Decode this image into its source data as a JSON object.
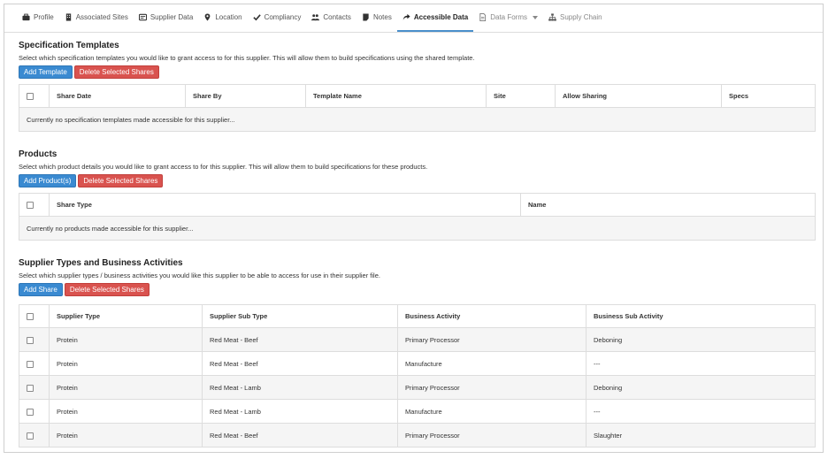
{
  "tabs": [
    {
      "label": "Profile",
      "icon": "briefcase-icon"
    },
    {
      "label": "Associated Sites",
      "icon": "building-icon"
    },
    {
      "label": "Supplier Data",
      "icon": "id-card-icon"
    },
    {
      "label": "Location",
      "icon": "map-marker-icon"
    },
    {
      "label": "Compliancy",
      "icon": "check-icon"
    },
    {
      "label": "Contacts",
      "icon": "users-icon"
    },
    {
      "label": "Notes",
      "icon": "note-icon"
    },
    {
      "label": "Accessible Data",
      "icon": "share-icon"
    },
    {
      "label": "Data Forms",
      "icon": "file-icon"
    },
    {
      "label": "Supply Chain",
      "icon": "sitemap-icon"
    }
  ],
  "active_tab": "Accessible Data",
  "colors": {
    "primary": "#3a8ad1",
    "danger": "#d9534f",
    "active_underline": "#4a8fcb"
  },
  "spec_templates": {
    "title": "Specification Templates",
    "description": "Select which specification templates you would like to grant access to for this supplier. This will allow them to build specifications using the shared template.",
    "add_label": "Add Template",
    "delete_label": "Delete Selected Shares",
    "columns": [
      "Share Date",
      "Share By",
      "Template Name",
      "Site",
      "Allow Sharing",
      "Specs"
    ],
    "empty_text": "Currently no specification templates made accessible for this supplier..."
  },
  "products": {
    "title": "Products",
    "description": "Select which product details you would like to grant access to for this supplier. This will allow them to build specifications for these products.",
    "add_label": "Add Product(s)",
    "delete_label": "Delete Selected Shares",
    "columns": [
      "Share Type",
      "Name"
    ],
    "empty_text": "Currently no products made accessible for this supplier..."
  },
  "supplier_types": {
    "title": "Supplier Types and Business Activities",
    "description": "Select which supplier types / business activities you would like this supplier to be able to access for use in their supplier file.",
    "add_label": "Add Share",
    "delete_label": "Delete Selected Shares",
    "columns": [
      "Supplier Type",
      "Supplier Sub Type",
      "Business Activity",
      "Business Sub Activity"
    ],
    "rows": [
      [
        "Protein",
        "Red Meat - Beef",
        "Primary Processor",
        "Deboning"
      ],
      [
        "Protein",
        "Red Meat - Beef",
        "Manufacture",
        "---"
      ],
      [
        "Protein",
        "Red Meat - Lamb",
        "Primary Processor",
        "Deboning"
      ],
      [
        "Protein",
        "Red Meat - Lamb",
        "Manufacture",
        "---"
      ],
      [
        "Protein",
        "Red Meat - Beef",
        "Primary Processor",
        "Slaughter"
      ]
    ]
  }
}
